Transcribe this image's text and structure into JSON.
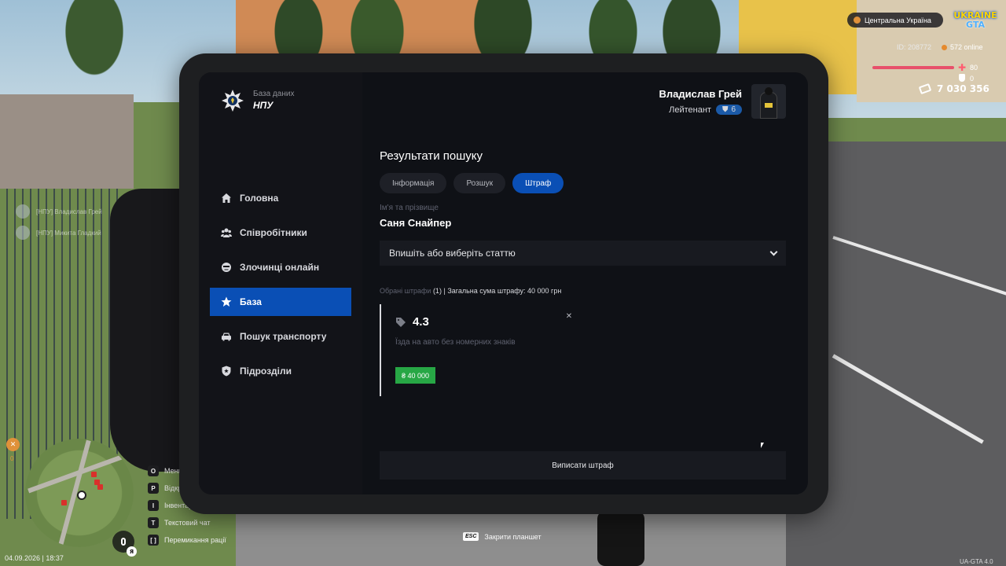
{
  "hud": {
    "region": "Центральна Україна",
    "logo_top": "UKRAINE",
    "logo_bottom": "GTA",
    "player_id": "ID: 208772",
    "online": "572 online",
    "health": "80",
    "armor": "0",
    "money": "7 030 356",
    "feed": [
      "[НПУ] Владислав Грей",
      "[НПУ] Микита Гладкий"
    ],
    "keys": [
      {
        "key": "O",
        "label": "Меню"
      },
      {
        "key": "P",
        "label": "Відкрити"
      },
      {
        "key": "I",
        "label": "Інвентар"
      },
      {
        "key": "T",
        "label": "Текстовий чат"
      },
      {
        "key": "[ ]",
        "label": "Перемикання рації"
      }
    ],
    "map_badge_count": "0",
    "mic_key": "Я",
    "datetime": "04.09.2026 | 18:37",
    "esc_key": "ESC",
    "esc_label": "Закрити планшет",
    "version": "UA-GTA 4.0"
  },
  "brand": {
    "subtitle": "База даних",
    "title": "НПУ"
  },
  "user": {
    "name": "Владислав Грей",
    "rank": "Лейтенант",
    "level": "6"
  },
  "nav": [
    {
      "label": "Головна",
      "icon": "home-icon"
    },
    {
      "label": "Співробітники",
      "icon": "users-icon"
    },
    {
      "label": "Злочинці онлайн",
      "icon": "criminal-icon"
    },
    {
      "label": "База",
      "icon": "star-icon",
      "active": true
    },
    {
      "label": "Пошук транспорту",
      "icon": "car-icon"
    },
    {
      "label": "Підрозділи",
      "icon": "shield-icon"
    }
  ],
  "main": {
    "title": "Результати пошуку",
    "tabs": [
      {
        "label": "Інформація"
      },
      {
        "label": "Розшук"
      },
      {
        "label": "Штраф",
        "active": true
      }
    ],
    "field_label": "Ім'я та прізвище",
    "field_value": "Саня Снайпер",
    "select_placeholder": "Впишіть або виберіть статтю",
    "summary_label": "Обрані штрафи",
    "summary_count": "(1)",
    "summary_sep": "|",
    "summary_total": "Загальна сума штрафу: 40 000 грн",
    "fines": [
      {
        "code": "4.3",
        "description": "Їзда на авто без номерних знаків",
        "price": "₴ 40 000"
      }
    ],
    "submit_label": "Виписати штраф"
  },
  "colors": {
    "accent": "#0a4fb5",
    "price_badge": "#27a745",
    "screen_bg": "#0f1116"
  }
}
